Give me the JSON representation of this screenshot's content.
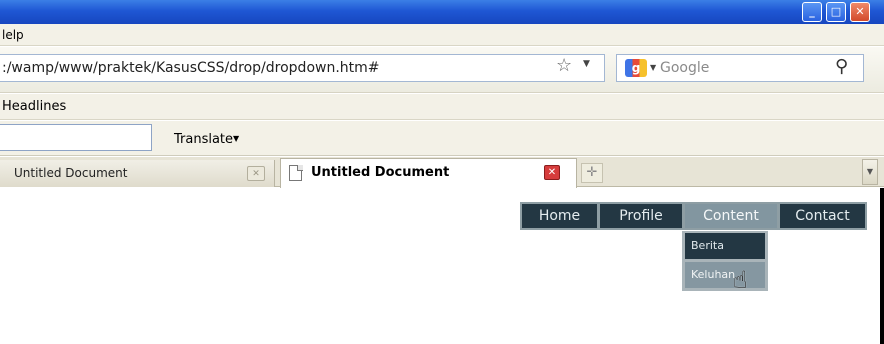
{
  "menu_bar": {
    "help_label": "lelp"
  },
  "address_bar": {
    "url": ":/wamp/www/praktek/KasusCSS/drop/dropdown.htm#"
  },
  "search_bar": {
    "placeholder": "Google"
  },
  "bookmarks_bar": {
    "item_label": "Headlines"
  },
  "google_toolbar": {
    "translate_label": "Translate"
  },
  "tabs": [
    {
      "label": "Untitled Document",
      "active": false
    },
    {
      "label": "Untitled Document",
      "active": true
    }
  ],
  "page": {
    "nav_menu": [
      {
        "label": "Home",
        "active": false
      },
      {
        "label": "Profile",
        "active": false
      },
      {
        "label": "Content",
        "active": true
      },
      {
        "label": "Contact",
        "active": false
      }
    ],
    "submenu": [
      {
        "label": "Berita",
        "hovered": false
      },
      {
        "label": "Keluhan",
        "hovered": true
      }
    ]
  },
  "colors": {
    "menu_bg": "#233743",
    "menu_active_bg": "#8296a0",
    "titlebar": "#1f57d4"
  },
  "icons": [
    "star-icon",
    "google-logo-icon",
    "magnifier-icon",
    "document-icon",
    "tab-close-icon",
    "new-tab-icon",
    "hand-cursor-icon"
  ]
}
